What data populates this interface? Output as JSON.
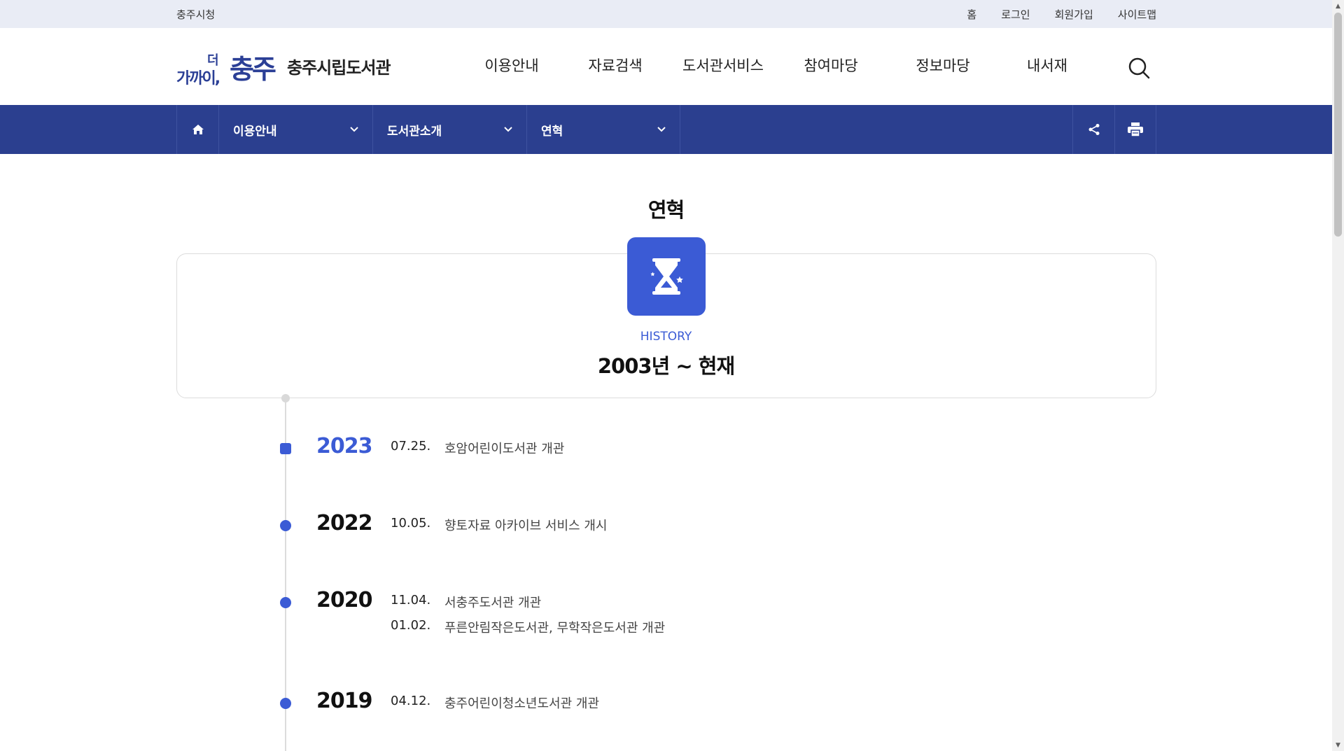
{
  "util": {
    "left_link": "충주시청",
    "links": [
      "홈",
      "로그인",
      "회원가입",
      "사이트맵"
    ]
  },
  "header": {
    "logo_small": "가까이,",
    "logo_tiny": "더",
    "logo_big": "충주",
    "library_name": "충주시립도서관",
    "nav": [
      "이용안내",
      "자료검색",
      "도서관서비스",
      "참여마당",
      "정보마당",
      "내서재"
    ]
  },
  "location": {
    "depth1": "이용안내",
    "depth2": "도서관소개",
    "depth3": "연혁"
  },
  "page": {
    "title": "연혁",
    "history_label": "HISTORY",
    "period": "2003년 ~ 현재"
  },
  "timeline": [
    {
      "year": "2023",
      "active": true,
      "entries": [
        {
          "date": "07.25.",
          "desc": "호암어린이도서관 개관"
        }
      ]
    },
    {
      "year": "2022",
      "active": false,
      "entries": [
        {
          "date": "10.05.",
          "desc": "향토자료 아카이브 서비스 개시"
        }
      ]
    },
    {
      "year": "2020",
      "active": false,
      "entries": [
        {
          "date": "11.04.",
          "desc": "서충주도서관 개관"
        },
        {
          "date": "01.02.",
          "desc": "푸른안림작은도서관, 무학작은도서관 개관"
        }
      ]
    },
    {
      "year": "2019",
      "active": false,
      "entries": [
        {
          "date": "04.12.",
          "desc": "충주어린이청소년도서관 개관"
        }
      ]
    }
  ],
  "colors": {
    "brand_navy": "#2b3f8f",
    "accent_blue": "#3b5bd5",
    "util_bg": "#e9ecf5"
  }
}
